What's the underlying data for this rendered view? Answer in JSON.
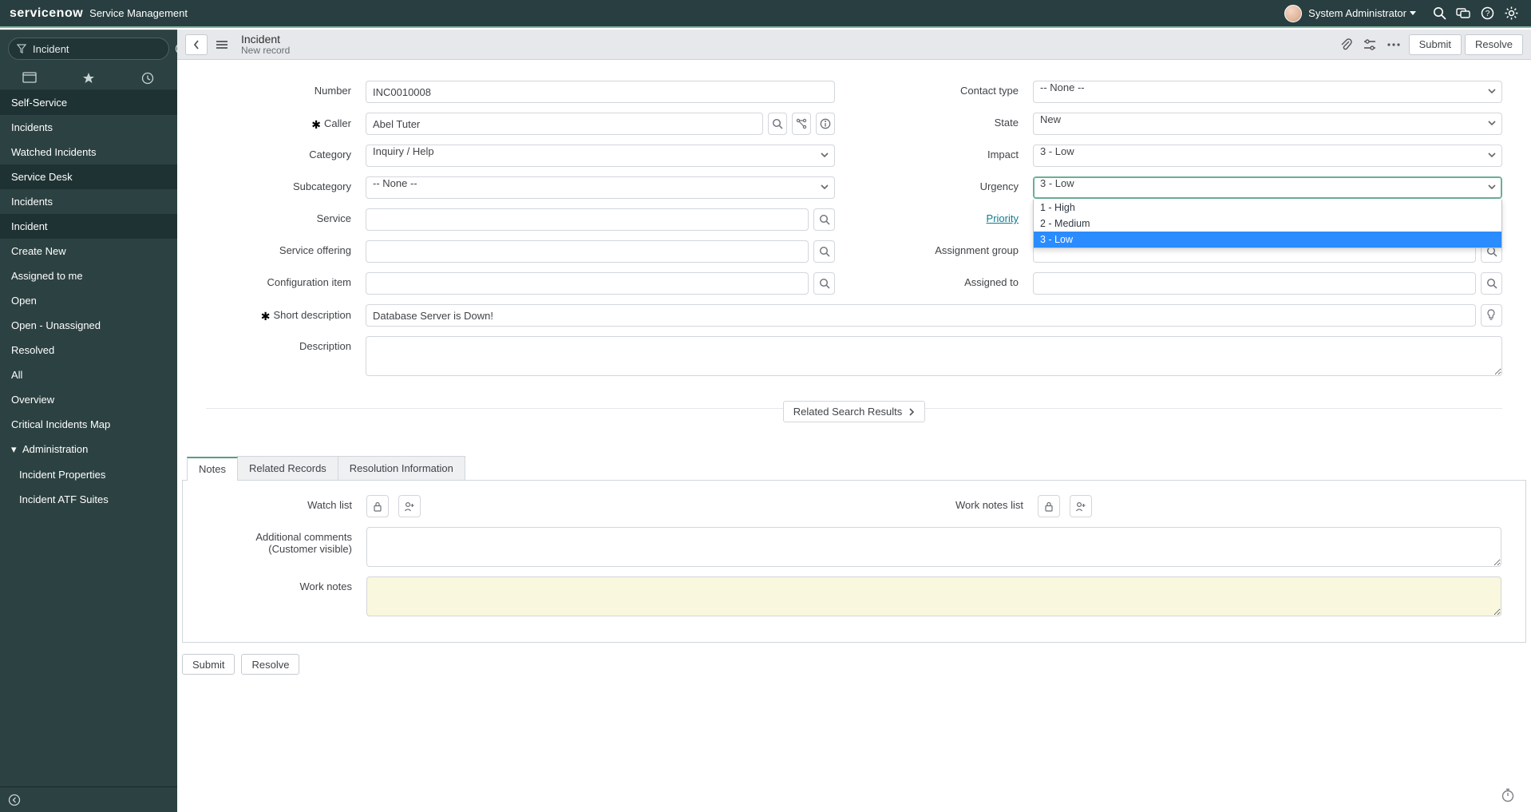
{
  "banner": {
    "logo": "servicenow",
    "product": "Service Management",
    "user": "System Administrator"
  },
  "nav": {
    "filter_value": "Incident",
    "sections": {
      "self_service": "Self-Service",
      "self_service_items": [
        "Incidents",
        "Watched Incidents"
      ],
      "service_desk": "Service Desk",
      "service_desk_items": [
        "Incidents"
      ],
      "incident": "Incident",
      "incident_items": [
        "Create New",
        "Assigned to me",
        "Open",
        "Open - Unassigned",
        "Resolved",
        "All",
        "Overview",
        "Critical Incidents Map"
      ],
      "administration": "Administration",
      "admin_items": [
        "Incident Properties",
        "Incident ATF Suites"
      ]
    }
  },
  "header": {
    "title": "Incident",
    "subtitle": "New record",
    "submit": "Submit",
    "resolve": "Resolve"
  },
  "fields": {
    "left": {
      "number_label": "Number",
      "number_value": "INC0010008",
      "caller_label": "Caller",
      "caller_value": "Abel Tuter",
      "category_label": "Category",
      "category_value": "Inquiry / Help",
      "subcategory_label": "Subcategory",
      "subcategory_value": "-- None --",
      "service_label": "Service",
      "service_offering_label": "Service offering",
      "ci_label": "Configuration item",
      "short_desc_label": "Short description",
      "short_desc_value": "Database Server is Down!",
      "description_label": "Description"
    },
    "right": {
      "contact_type_label": "Contact type",
      "contact_type_value": "-- None --",
      "state_label": "State",
      "state_value": "New",
      "impact_label": "Impact",
      "impact_value": "3 - Low",
      "urgency_label": "Urgency",
      "urgency_value": "3 - Low",
      "urgency_options": [
        "1 - High",
        "2 - Medium",
        "3 - Low"
      ],
      "priority_label": "Priority",
      "assignment_group_label": "Assignment group",
      "assigned_to_label": "Assigned to"
    }
  },
  "related_search": "Related Search Results",
  "tabs": {
    "notes": "Notes",
    "related_records": "Related Records",
    "resolution_info": "Resolution Information",
    "watch_list": "Watch list",
    "work_notes_list": "Work notes list",
    "additional_comments": "Additional comments (Customer visible)",
    "work_notes": "Work notes"
  },
  "actions": {
    "submit": "Submit",
    "resolve": "Resolve"
  }
}
